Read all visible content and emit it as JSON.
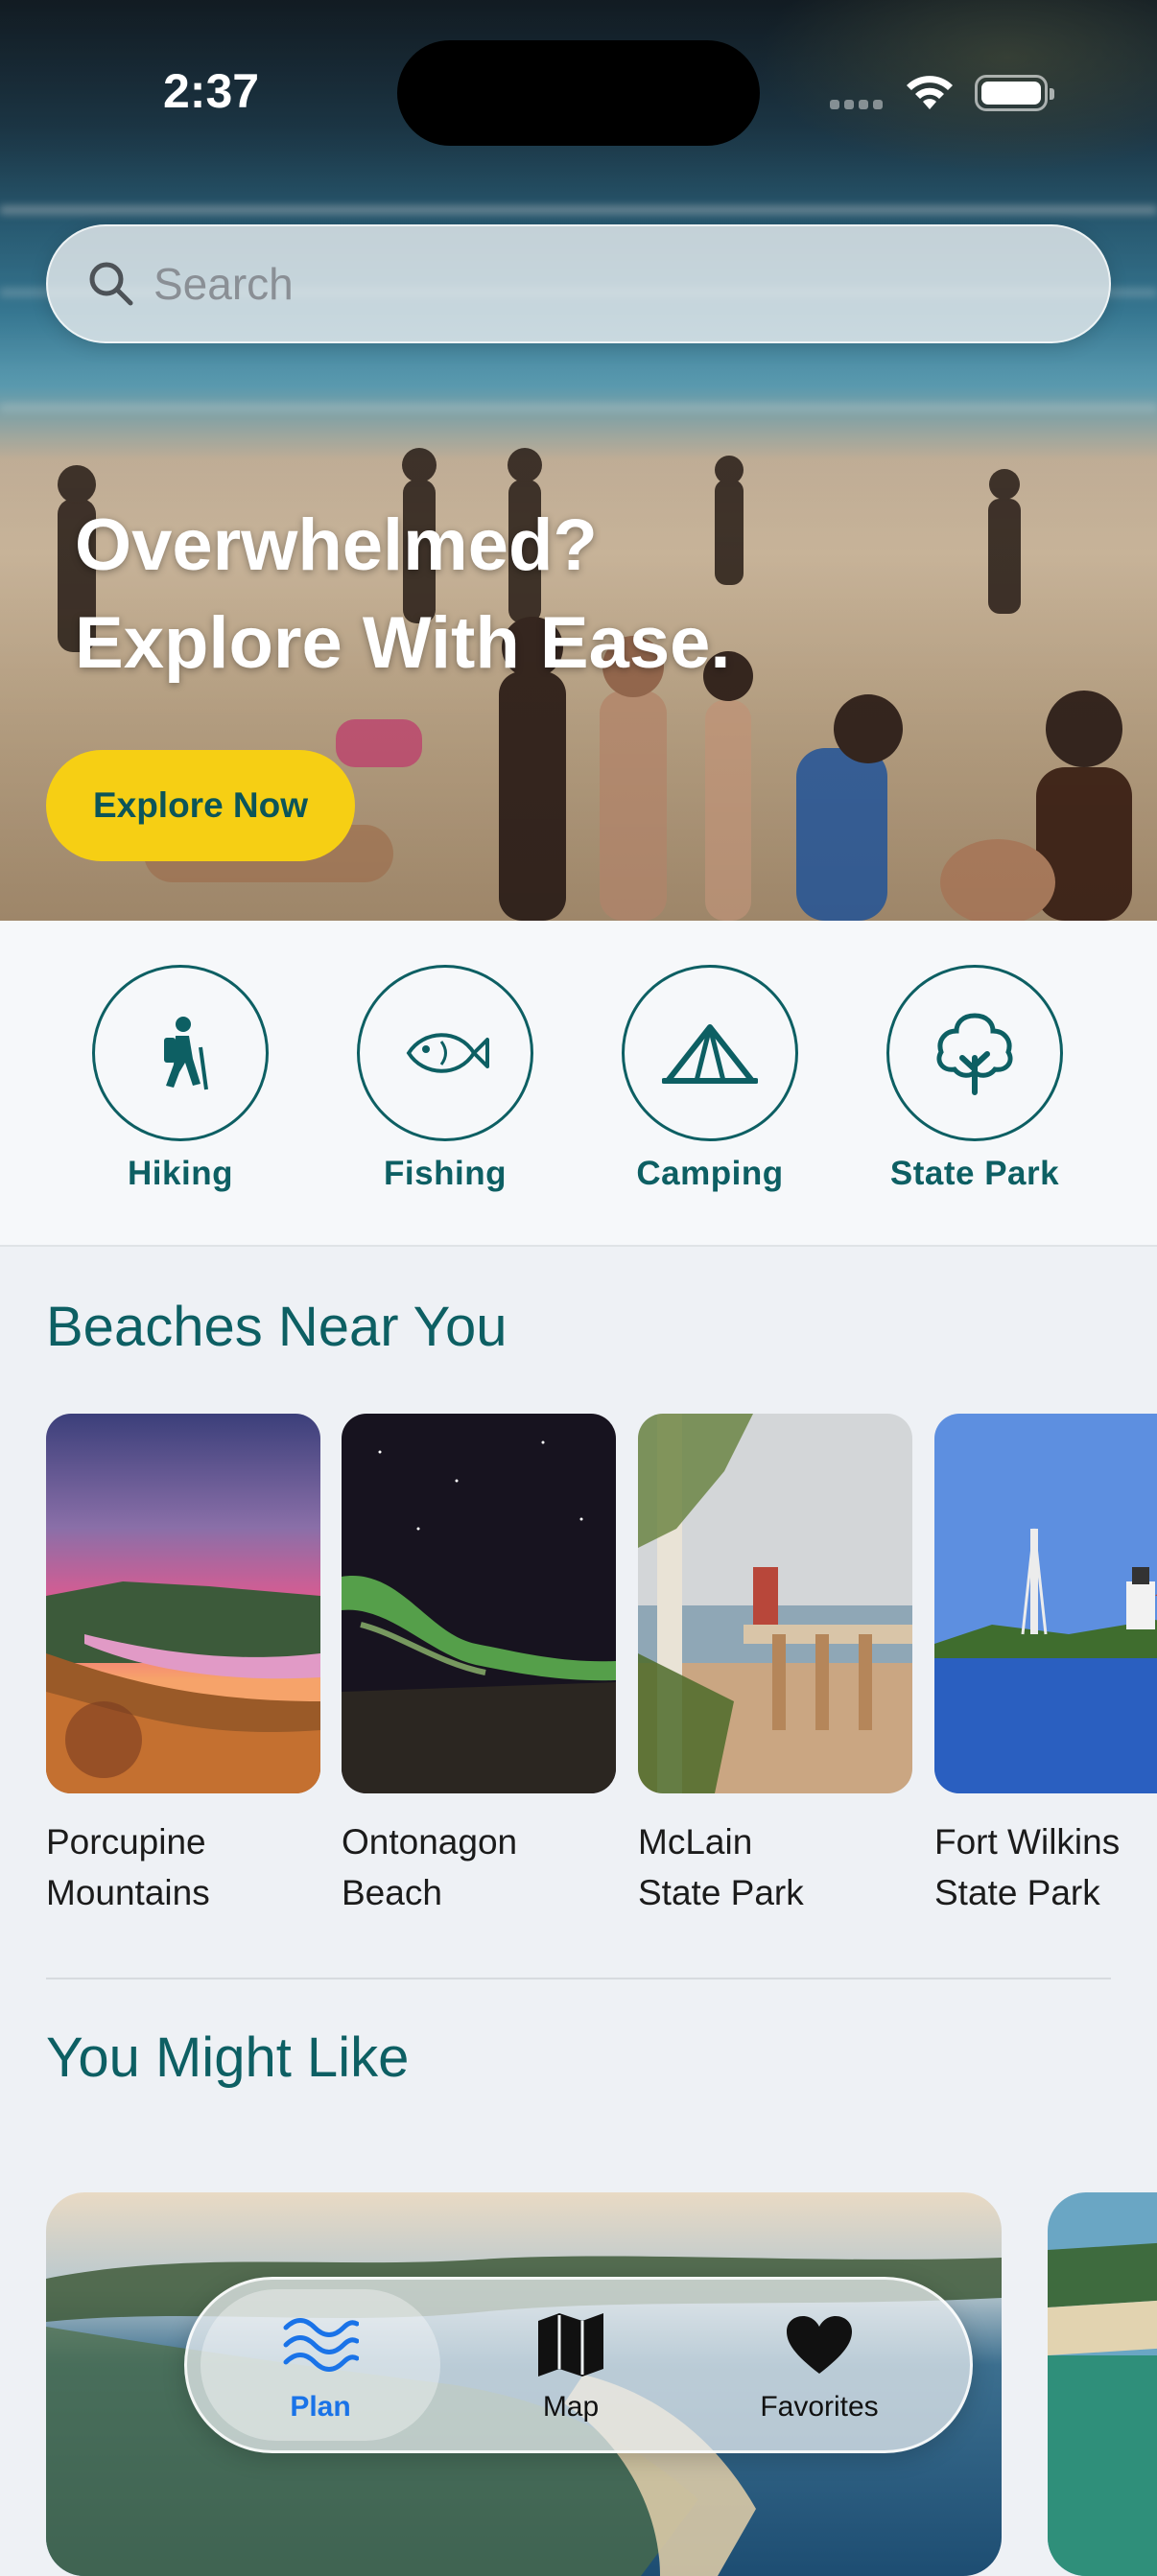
{
  "status": {
    "time": "2:37"
  },
  "search": {
    "placeholder": "Search"
  },
  "hero": {
    "headline_line1": "Overwhelmed?",
    "headline_line2": "Explore With Ease.",
    "cta_label": "Explore Now"
  },
  "categories": [
    {
      "label": "Hiking",
      "icon": "hiking-icon"
    },
    {
      "label": "Fishing",
      "icon": "fish-icon"
    },
    {
      "label": "Camping",
      "icon": "tent-icon"
    },
    {
      "label": "State Park",
      "icon": "tree-icon"
    }
  ],
  "beaches": {
    "title": "Beaches Near You",
    "items": [
      {
        "line1": "Porcupine",
        "line2": "Mountains"
      },
      {
        "line1": "Ontonagon",
        "line2": "Beach"
      },
      {
        "line1": "McLain",
        "line2": "State Park"
      },
      {
        "line1": "Fort Wilkins",
        "line2": "State Park"
      }
    ]
  },
  "might_like": {
    "title": "You Might Like"
  },
  "tabbar": {
    "tabs": [
      {
        "label": "Plan",
        "icon": "waves-icon",
        "active": true
      },
      {
        "label": "Map",
        "icon": "map-icon",
        "active": false
      },
      {
        "label": "Favorites",
        "icon": "heart-icon",
        "active": false
      }
    ]
  },
  "colors": {
    "accent": "#0d5f63",
    "cta": "#f6cf14",
    "active_tab": "#1a73e8"
  }
}
